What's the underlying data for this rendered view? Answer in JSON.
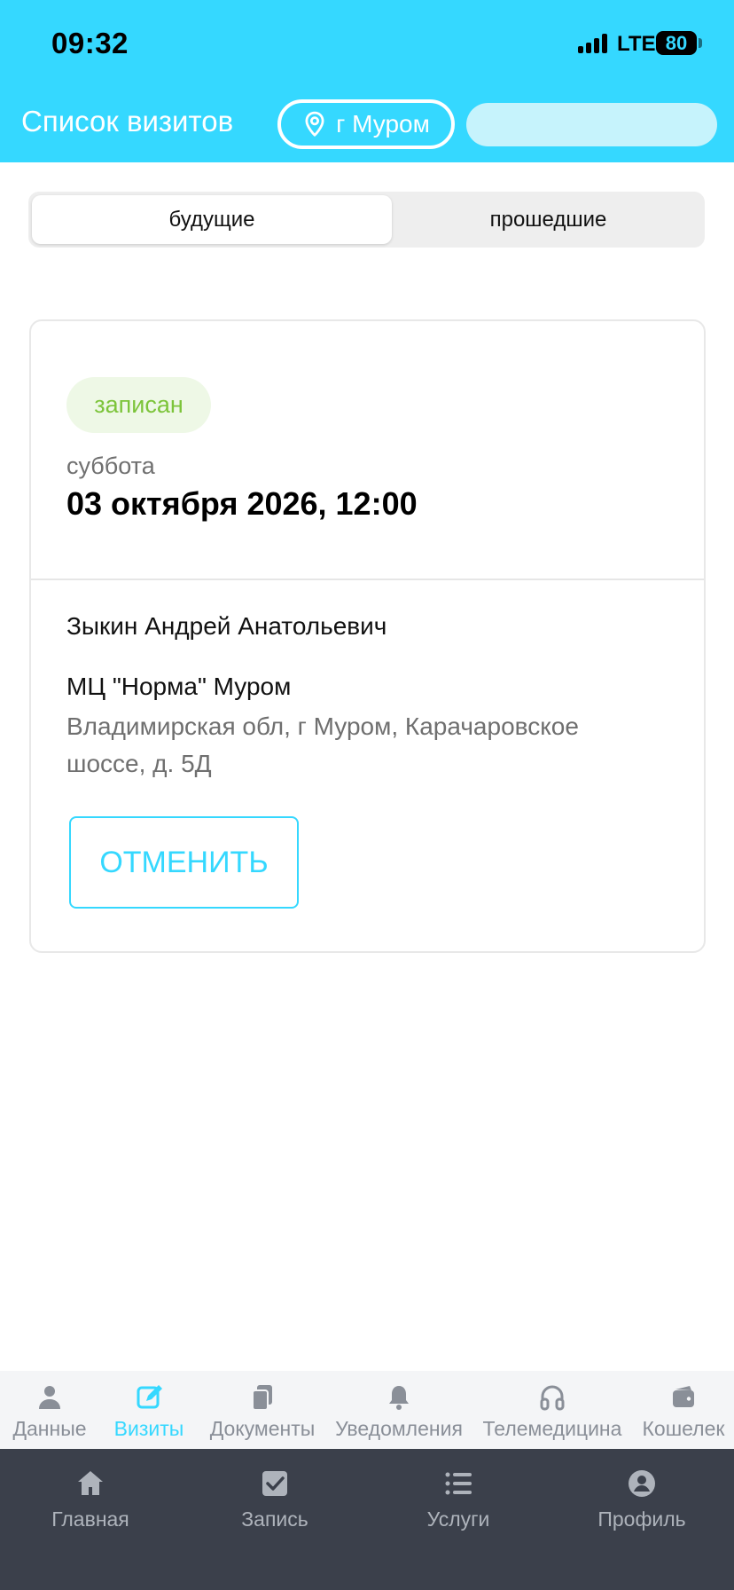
{
  "status_bar": {
    "time": "09:32",
    "network": "LTE",
    "battery": "80"
  },
  "header": {
    "title": "Список визитов",
    "city": "г Муром"
  },
  "tabs": {
    "future": "будущие",
    "past": "прошедшие"
  },
  "visit": {
    "status": "записан",
    "weekday": "суббота",
    "datetime": "03 октября 2026, 12:00",
    "doctor": "Зыкин Андрей Анатольевич",
    "clinic": "МЦ \"Норма\" Муром",
    "address": "Владимирская обл, г Муром, Карачаровское шоссе, д. 5Д",
    "cancel_label": "ОТМЕНИТЬ"
  },
  "subnav": {
    "items": [
      {
        "label": "Данные",
        "icon": "person-icon"
      },
      {
        "label": "Визиты",
        "icon": "edit-icon"
      },
      {
        "label": "Документы",
        "icon": "documents-icon"
      },
      {
        "label": "Уведомления",
        "icon": "bell-icon"
      },
      {
        "label": "Телемедицина",
        "icon": "headphones-icon"
      },
      {
        "label": "Кошелек",
        "icon": "wallet-icon"
      }
    ]
  },
  "tabbar": {
    "items": [
      {
        "label": "Главная",
        "icon": "home-icon"
      },
      {
        "label": "Запись",
        "icon": "checkbox-icon"
      },
      {
        "label": "Услуги",
        "icon": "list-icon"
      },
      {
        "label": "Профиль",
        "icon": "profile-icon"
      }
    ]
  },
  "colors": {
    "accent": "#35d8ff",
    "status_green": "#7cc43a",
    "tabbar_bg": "#3b404b"
  }
}
